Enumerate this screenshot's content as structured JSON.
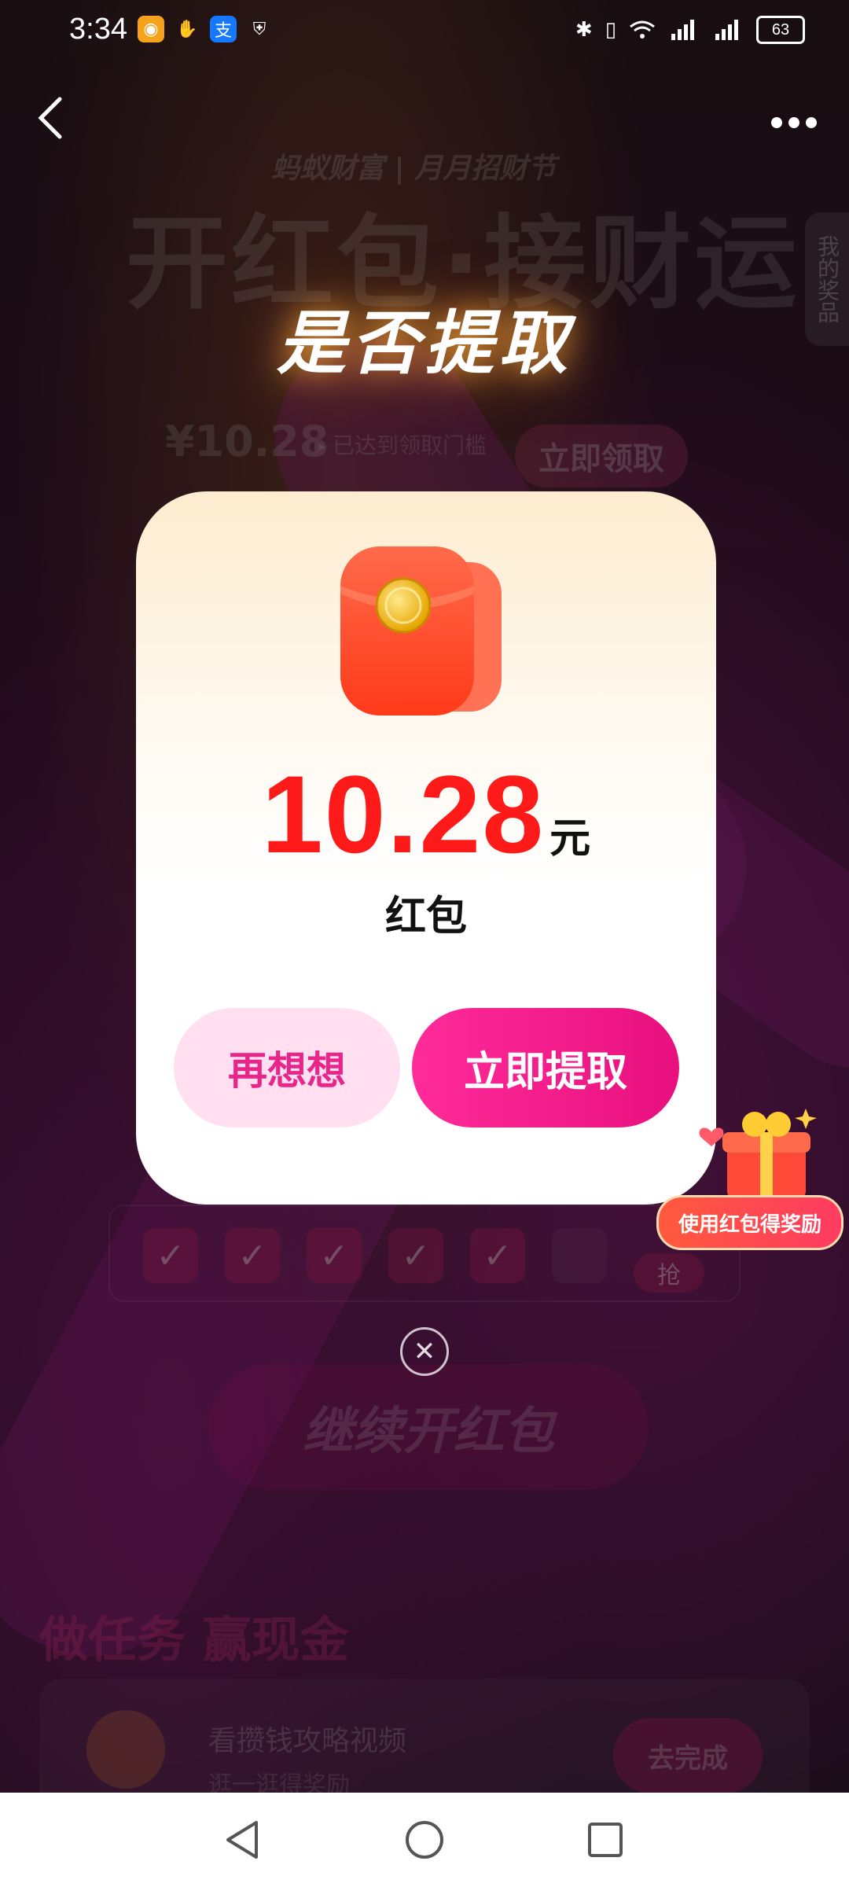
{
  "status_bar": {
    "time": "3:34",
    "battery": "63",
    "icons_left": [
      "app-icon",
      "hand-icon",
      "alipay-icon",
      "shield-icon"
    ],
    "icons_right": [
      "bluetooth-icon",
      "vibrate-icon",
      "wifi-icon",
      "signal-4g-icon",
      "signal-4g-icon",
      "battery-icon"
    ]
  },
  "background": {
    "brand": "蚂蚁财富 | 月月招财节",
    "big_title": "开红包·接财运",
    "side_tab": "我的奖品",
    "amount": "¥10.28",
    "threshold": "▸ 已达到领取门槛",
    "claim_button": "立即领取",
    "continue_button": "继续开红包",
    "task_section_title": "做任务 赢现金",
    "task_name": "看攒钱攻略视频",
    "task_sub": "逛一逛得奖励",
    "task_button": "去完成",
    "checks": [
      "✓",
      "✓",
      "✓",
      "✓",
      "✓",
      "",
      ""
    ],
    "last_check_label": "抢"
  },
  "dialog": {
    "title": "是否提取",
    "amount": "10.28",
    "unit": "元",
    "label": "红包",
    "cancel_label": "再想想",
    "confirm_label": "立即提取"
  },
  "promo": {
    "label": "使用红包得奖励"
  },
  "colors": {
    "accent": "#ff1a1a",
    "button_pink": "#e8107e",
    "button_light": "#ffdff0"
  }
}
